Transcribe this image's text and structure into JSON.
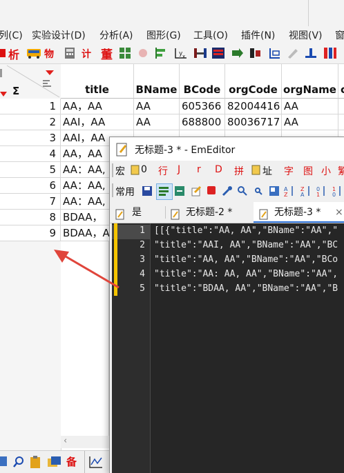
{
  "app": {
    "menu": [
      "列(C)",
      "实验设计(D)",
      "分析(A)",
      "图形(G)",
      "工具(O)",
      "插件(N)",
      "视图(V)",
      "窗"
    ],
    "toolbar_text": [
      "析",
      "物",
      "计",
      "董"
    ]
  },
  "table": {
    "sigma": "Σ",
    "columns": [
      "title",
      "BName",
      "BCode",
      "orgCode",
      "orgName"
    ],
    "rows": [
      {
        "n": "1",
        "title": "AA，AA",
        "BName": "AA",
        "BCode": "605366",
        "orgCode": "82004416",
        "orgName": "AA"
      },
      {
        "n": "2",
        "title": "AAI，AA",
        "BName": "AA",
        "BCode": "688800",
        "orgCode": "80036717",
        "orgName": "AA"
      },
      {
        "n": "3",
        "title": "AAI，AA"
      },
      {
        "n": "4",
        "title": "AA，AA"
      },
      {
        "n": "5",
        "title": "AA：AA,"
      },
      {
        "n": "6",
        "title": "AA：AA,"
      },
      {
        "n": "7",
        "title": "AA：AA,"
      },
      {
        "n": "8",
        "title": "BDAA，"
      },
      {
        "n": "9",
        "title": "BDAA，A"
      }
    ]
  },
  "emeditor": {
    "title": "无标题-3 * - EmEditor",
    "toolbar1": [
      "宏",
      "0",
      "行",
      "J",
      "r",
      "D",
      "拼",
      "址",
      "字",
      "图",
      "小",
      "繁"
    ],
    "toolbar2_label": "常用",
    "tabs": [
      "是",
      "无标题-2 *",
      "无标题-3 *"
    ],
    "tab_close": "×",
    "lines": [
      {
        "n": "1",
        "text": "[[{\"title\":\"AA, AA\",\"BName\":\"AA\",\""
      },
      {
        "n": "2",
        "text": "\"title\":\"AAI, AA\",\"BName\":\"AA\",\"BC"
      },
      {
        "n": "3",
        "text": "\"title\":\"AA, AA\",\"BName\":\"AA\",\"BCo"
      },
      {
        "n": "4",
        "text": "\"title\":\"AA: AA, AA\",\"BName\":\"AA\","
      },
      {
        "n": "5",
        "text": "\"title\":\"BDAA, AA\",\"BName\":\"AA\",\"B"
      }
    ]
  },
  "colors": {
    "accent_red": "#d11",
    "arrow": "#e0453b",
    "editor_bg": "#262626",
    "gutter_mark": "#f5c400"
  }
}
